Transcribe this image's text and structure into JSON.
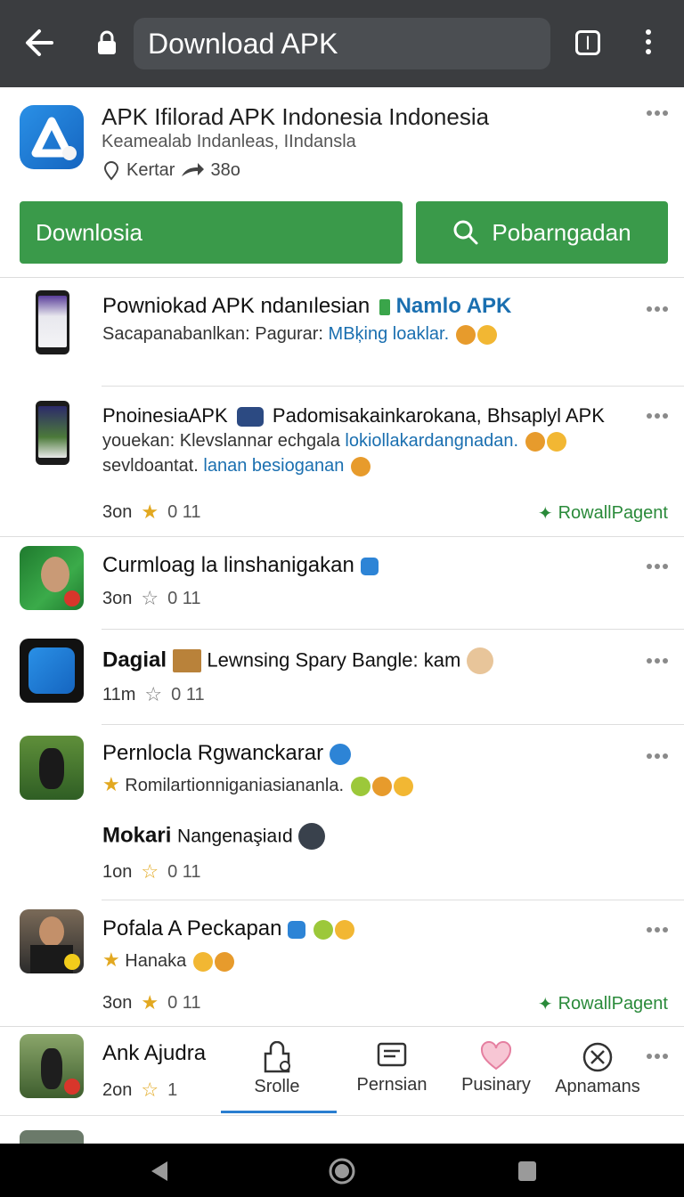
{
  "browser": {
    "url": "Download APK"
  },
  "app": {
    "title": "APK Ifilorad APK Indonesia Indonesia",
    "subtitle": "Keamealab Indanleas, IIndansla",
    "location": "Kertar",
    "count": "38o",
    "download_label": "Downlosia",
    "search_label": "Pobarngadan"
  },
  "feed": [
    {
      "title": "Powniokad APK ndanılesian",
      "title_tag": "Namlo APK",
      "line1_a": "Sacapanabanlkan: Pagurar:",
      "line1_b": "MBķing loaklar."
    },
    {
      "title": "PnoinesiaAPK",
      "title_rest": "Padomisakainkarokana, Bhsaplyl APK",
      "line1_a": "youekan: Klevslannar echgala",
      "line1_b": "lokiollakardangnadan.",
      "line2_a": "sevldoantat.",
      "line2_b": "lanan besioganan",
      "time": "3on",
      "rating": "0 11",
      "tag": "RowallPagent"
    },
    {
      "title": "Curmloag la linshanigakan",
      "time": "3on",
      "rating": "0 11"
    },
    {
      "title": "Dagial",
      "title_rest": "Lewnsing Spary Bangle: kam",
      "time": "11m",
      "rating": "0 11"
    },
    {
      "title": "Pernlocla Rgwanckarar",
      "line1": "Romilartionniganiasiananla.",
      "subtitle": "Mokari",
      "subtitle_rest": "Nangenaşiaıd",
      "time": "1on",
      "rating": "0 11"
    },
    {
      "title": "Pofala A Peckapan",
      "line1": "Hanaka",
      "time": "3on",
      "rating": "0 11",
      "tag": "RowallPagent"
    },
    {
      "title": "Ank Ajudra",
      "time": "2on",
      "rating": "1"
    }
  ],
  "bottom_tabs": [
    {
      "label": "Srolle",
      "icon": "bag-icon"
    },
    {
      "label": "Pernsian",
      "icon": "message-icon"
    },
    {
      "label": "Pusinary",
      "icon": "heart-icon"
    },
    {
      "label": "Apnamans",
      "icon": "compass-icon"
    }
  ],
  "colors": {
    "topbar": "#3b3d40",
    "green": "#3a9a4a",
    "blue_link": "#1a6fb0",
    "accent": "#2a7ed0"
  }
}
